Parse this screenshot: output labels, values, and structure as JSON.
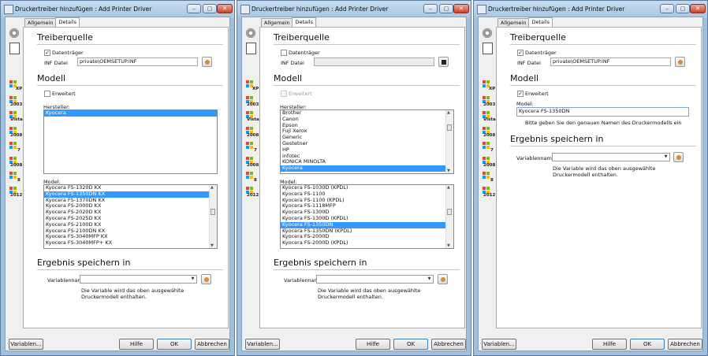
{
  "windows": [
    {
      "title": "Druckertreiber hinzufügen : Add Printer Driver",
      "tabs": [
        "Allgemein",
        "Details"
      ],
      "os": [
        "XP",
        "2003",
        "Vista",
        "2008",
        "7",
        "2008",
        "8",
        "2012"
      ],
      "source_heading": "Treiberquelle",
      "media_checkbox": "Datenträger",
      "inf_label": "INF Datei",
      "inf_value": "private\\OEMSETUP.INF",
      "model_heading": "Modell",
      "extended_checkbox": "Erweitert",
      "manufacturer_label": "Hersteller:",
      "manufacturers": [
        "Kyocera"
      ],
      "model_label": "Model:",
      "models": [
        "Kyocera FS-1320D KX",
        "Kyocera FS-1350DN KX",
        "Kyocera FS-1370DN KX",
        "Kyocera FS-2000D KX",
        "Kyocera FS-2020D KX",
        "Kyocera FS-2025D KX",
        "Kyocera FS-2100D KX",
        "Kyocera FS-2100DN KX",
        "Kyocera FS-3040MFP KX",
        "Kyocera FS-3040MFP+ KX"
      ],
      "result_heading": "Ergebnis speichern in",
      "varname_label": "Variablenname",
      "varname_value": "",
      "note": "Die Variable wird das oben ausgewählte Druckermodell enthalten.",
      "btn_variables": "Variablen...",
      "btn_help": "Hilfe",
      "btn_ok": "OK",
      "btn_cancel": "Abbrechen"
    },
    {
      "title": "Druckertreiber hinzufügen : Add Printer Driver",
      "tabs": [
        "Allgemein",
        "Details"
      ],
      "os": [
        "XP",
        "2003",
        "Vista",
        "2008",
        "7",
        "2008",
        "8",
        "2012"
      ],
      "source_heading": "Treiberquelle",
      "media_checkbox": "Datenträger",
      "inf_label": "INF Datei",
      "inf_value": "",
      "model_heading": "Modell",
      "extended_checkbox": "Erweitert",
      "manufacturer_label": "Hersteller:",
      "manufacturers": [
        "Brother",
        "Canon",
        "Epson",
        "Fuji Xerox",
        "Generic",
        "Gestetner",
        "HP",
        "infotec",
        "KONICA MINOLTA",
        "Kyocera"
      ],
      "model_label": "Model:",
      "models": [
        "Kyocera FS-1030D (KPDL)",
        "Kyocera FS-1100",
        "Kyocera FS-1100 (KPDL)",
        "Kyocera FS-1118MFP",
        "Kyocera FS-1300D",
        "Kyocera FS-1300D (KPDL)",
        "Kyocera FS-1350DN",
        "Kyocera FS-1350DN (KPDL)",
        "Kyocera FS-2000D",
        "Kyocera FS-2000D (KPDL)"
      ],
      "result_heading": "Ergebnis speichern in",
      "varname_label": "Variablenname",
      "varname_value": "",
      "note": "Die Variable wird das oben ausgewählte Druckermodell enthalten.",
      "btn_variables": "Variablen...",
      "btn_help": "Hilfe",
      "btn_ok": "OK",
      "btn_cancel": "Abbrechen"
    },
    {
      "title": "Druckertreiber hinzufügen : Add Printer Driver",
      "tabs": [
        "Allgemein",
        "Details"
      ],
      "os": [
        "XP",
        "2003",
        "Vista",
        "2008",
        "7",
        "2008",
        "8",
        "2012"
      ],
      "source_heading": "Treiberquelle",
      "media_checkbox": "Datenträger",
      "inf_label": "INF Datei",
      "inf_value": "private\\OEMSETUP.INF",
      "model_heading": "Modell",
      "extended_checkbox": "Erweitert",
      "model_label": "Model:",
      "model_value": "Kyocera FS-1350DN",
      "model_hint": "Bitte geben Sie den genauen Namen des Druckermodells ein",
      "result_heading": "Ergebnis speichern in",
      "varname_label": "Variablenname",
      "varname_value": "",
      "note": "Die Variable wird das oben ausgewählte Druckermodell enthalten.",
      "btn_variables": "Variablen...",
      "btn_help": "Hilfe",
      "btn_ok": "OK",
      "btn_cancel": "Abbrechen"
    }
  ]
}
